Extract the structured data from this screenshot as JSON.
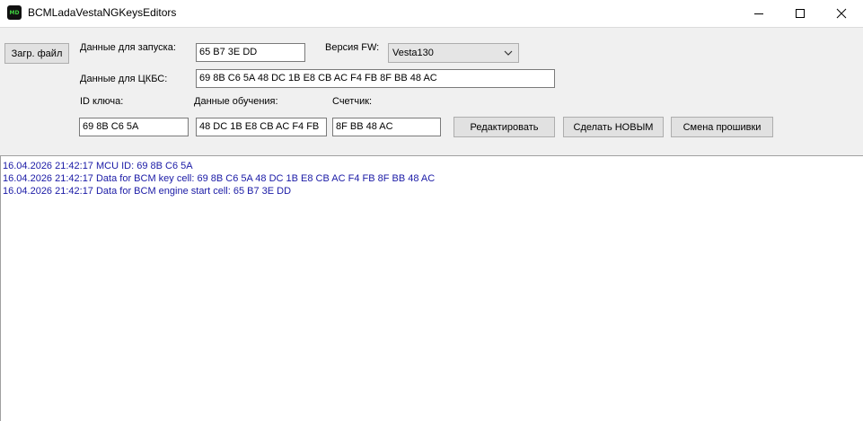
{
  "window": {
    "title": "BCMLadaVestaNGKeysEditors",
    "icon_text": "MD"
  },
  "toolbar": {
    "load_file_label": "Загр. файл",
    "launch_data_label": "Данные для запуска:",
    "launch_data_value": "65 B7 3E DD",
    "fw_version_label": "Версия FW:",
    "fw_version_value": "Vesta130",
    "ckbs_data_label": "Данные для ЦКБС:",
    "ckbs_data_value": "69 8B C6 5A 48 DC 1B E8 CB AC F4 FB 8F BB 48 AC",
    "key_id_label": "ID ключа:",
    "key_id_value": "69 8B C6 5A",
    "learn_data_label": "Данные обучения:",
    "learn_data_value": "48 DC 1B E8 CB AC F4 FB",
    "counter_label": "Счетчик:",
    "counter_value": "8F BB 48 AC",
    "edit_label": "Редактировать",
    "make_new_label": "Сделать НОВЫМ",
    "firmware_change_label": "Смена прошивки"
  },
  "log": {
    "lines": [
      "16.04.2026 21:42:17  MCU ID: 69 8B C6 5A",
      "16.04.2026 21:42:17  Data for BCM key cell: 69 8B C6 5A 48 DC 1B E8 CB AC F4 FB 8F BB 48 AC",
      "16.04.2026 21:42:17  Data for BCM engine start cell: 65 B7 3E DD"
    ],
    "color": "#1a1aa6"
  },
  "icons": [
    "minimize-icon",
    "maximize-icon",
    "close-icon",
    "chevron-down-icon"
  ]
}
